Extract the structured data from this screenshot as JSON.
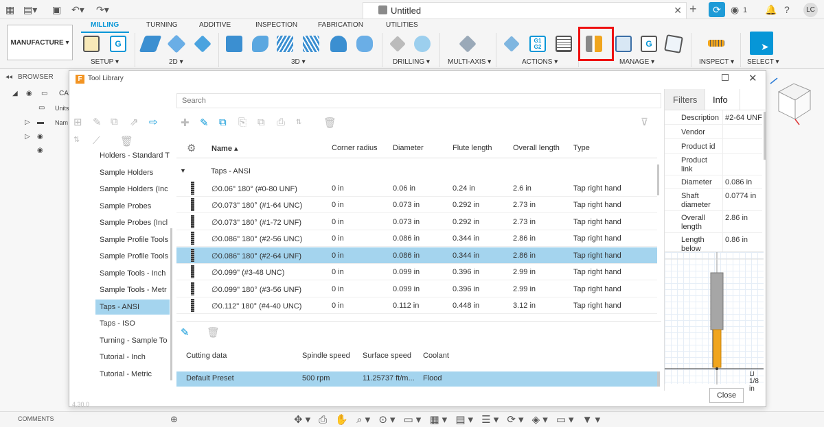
{
  "app": {
    "document_title": "Untitled",
    "notification_count": "1",
    "user_initials": "LC"
  },
  "ribbon": {
    "workspace": "MANUFACTURE",
    "tabs": [
      "MILLING",
      "TURNING",
      "ADDITIVE",
      "INSPECTION",
      "FABRICATION",
      "UTILITIES"
    ],
    "active_tab": "MILLING",
    "groups": [
      "SETUP",
      "2D",
      "3D",
      "DRILLING",
      "MULTI-AXIS",
      "ACTIONS",
      "MANAGE",
      "INSPECT",
      "SELECT"
    ],
    "g1g2_label": "G1\nG2"
  },
  "browser": {
    "header": "BROWSER",
    "rows": [
      "CA",
      "Units",
      "Nam"
    ]
  },
  "bottom": {
    "comments": "COMMENTS"
  },
  "dialog": {
    "title": "Tool Library",
    "search_placeholder": "Search",
    "version": "4.30.0",
    "close_label": "Close",
    "libraries": [
      "Holders - Standard T",
      "Sample Holders",
      "Sample Holders (Inc",
      "Sample Probes",
      "Sample Probes (Incl",
      "Sample Profile Tools",
      "Sample Profile Tools",
      "Sample Tools - Inch",
      "Sample Tools - Metr",
      "Taps - ANSI",
      "Taps - ISO",
      "Turning - Sample To",
      "Tutorial - Inch",
      "Tutorial - Metric"
    ],
    "selected_library": "Taps - ANSI",
    "columns": [
      "Name",
      "Corner radius",
      "Diameter",
      "Flute length",
      "Overall length",
      "Type"
    ],
    "group_label": "Taps - ANSI",
    "tools": [
      {
        "name": "∅0.06\" 180° (#0-80 UNF)",
        "corner": "0 in",
        "diameter": "0.06 in",
        "flute": "0.24 in",
        "overall": "2.6 in",
        "type": "Tap right hand"
      },
      {
        "name": "∅0.073\" 180° (#1-64 UNC)",
        "corner": "0 in",
        "diameter": "0.073 in",
        "flute": "0.292 in",
        "overall": "2.73 in",
        "type": "Tap right hand"
      },
      {
        "name": "∅0.073\" 180° (#1-72 UNF)",
        "corner": "0 in",
        "diameter": "0.073 in",
        "flute": "0.292 in",
        "overall": "2.73 in",
        "type": "Tap right hand"
      },
      {
        "name": "∅0.086\" 180° (#2-56 UNC)",
        "corner": "0 in",
        "diameter": "0.086 in",
        "flute": "0.344 in",
        "overall": "2.86 in",
        "type": "Tap right hand"
      },
      {
        "name": "∅0.086\" 180° (#2-64 UNF)",
        "corner": "0 in",
        "diameter": "0.086 in",
        "flute": "0.344 in",
        "overall": "2.86 in",
        "type": "Tap right hand"
      },
      {
        "name": "∅0.099\" (#3-48 UNC)",
        "corner": "0 in",
        "diameter": "0.099 in",
        "flute": "0.396 in",
        "overall": "2.99 in",
        "type": "Tap right hand"
      },
      {
        "name": "∅0.099\" 180° (#3-56 UNF)",
        "corner": "0 in",
        "diameter": "0.099 in",
        "flute": "0.396 in",
        "overall": "2.99 in",
        "type": "Tap right hand"
      },
      {
        "name": "∅0.112\" 180° (#4-40 UNC)",
        "corner": "0 in",
        "diameter": "0.112 in",
        "flute": "0.448 in",
        "overall": "3.12 in",
        "type": "Tap right hand"
      }
    ],
    "selected_tool_index": 4,
    "presets": {
      "columns": [
        "Cutting data",
        "Spindle speed",
        "Surface speed",
        "Coolant"
      ],
      "row": {
        "name": "Default Preset",
        "spindle": "500 rpm",
        "surface": "11.25737 ft/m...",
        "coolant": "Flood"
      }
    },
    "info_panel": {
      "tabs": [
        "Filters",
        "Info"
      ],
      "active_tab": "Info",
      "rows": [
        {
          "key": "Description",
          "value": "#2-64 UNF"
        },
        {
          "key": "Vendor",
          "value": ""
        },
        {
          "key": "Product id",
          "value": ""
        },
        {
          "key": "Product link",
          "value": ""
        },
        {
          "key": "Diameter",
          "value": "0.086 in"
        },
        {
          "key": "Shaft diameter",
          "value": "0.0774 in"
        },
        {
          "key": "Overall length",
          "value": "2.86 in"
        },
        {
          "key": "Length below",
          "value": "0.86 in"
        }
      ],
      "scale": "1/8 in"
    }
  },
  "colors": {
    "accent": "#0696d7",
    "selection": "#a4d4ee",
    "highlight_box": "#ee1111",
    "tool_flute": "#f0a51e"
  }
}
